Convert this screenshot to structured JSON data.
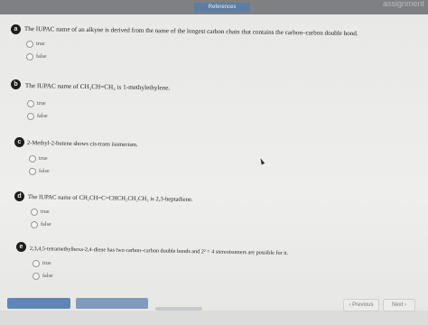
{
  "header": {
    "references_label": "References",
    "top_right_text": "assignment"
  },
  "questions": [
    {
      "badge": "a",
      "text": "The IUPAC name of an alkyne is derived from the name of the longest carbon chain that contains the carbon–carbon double bond.",
      "options": [
        "true",
        "false"
      ]
    },
    {
      "badge": "b",
      "text": "The IUPAC name of CH₃CH=CH₂ is 1-methylethylene.",
      "options": [
        "true",
        "false"
      ]
    },
    {
      "badge": "c",
      "text": "2-Methyl-2-butene shows cis-trans isomerism.",
      "options": [
        "true",
        "false"
      ]
    },
    {
      "badge": "d",
      "text": "The IUPAC name of CH₂CH=C=CHCH₂CH₂CH₃ is 2,3-heptadiene.",
      "options": [
        "true",
        "false"
      ]
    },
    {
      "badge": "e",
      "text": "2,3,4,5-tetramethylhexa-2,4-diene has two carbon–carbon double bonds and 2² = 4 stereoisomers are possible for it.",
      "options": [
        "true",
        "false"
      ]
    }
  ],
  "footer": {
    "previous_label": "Previous",
    "next_label": "Next"
  }
}
